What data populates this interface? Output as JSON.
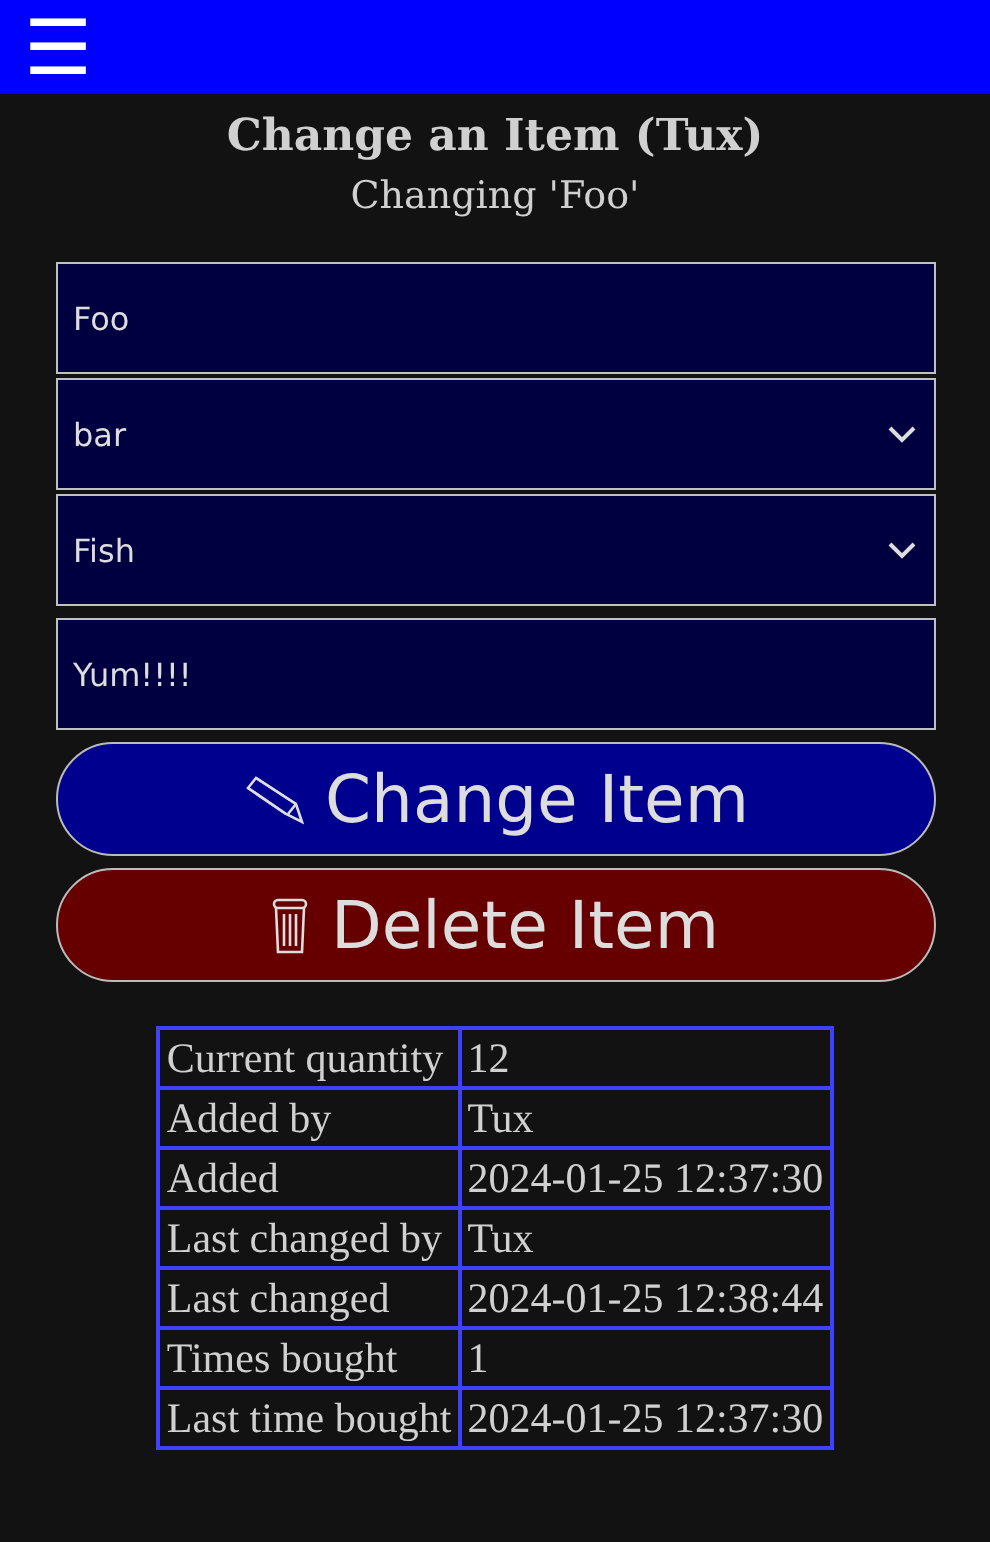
{
  "header": {
    "menu": "☰"
  },
  "title": "Change an Item (Tux)",
  "subtitle": "Changing 'Foo'",
  "fields": [
    {
      "kind": "text",
      "value": "Foo"
    },
    {
      "kind": "select",
      "value": "bar"
    },
    {
      "kind": "select",
      "value": "Fish"
    },
    {
      "kind": "text",
      "value": "Yum!!!!"
    }
  ],
  "buttons": [
    {
      "kind": "change",
      "label": "Change Item"
    },
    {
      "kind": "delete",
      "label": "Delete Item"
    }
  ],
  "details": [
    {
      "label": "Current quantity",
      "value": "12"
    },
    {
      "label": "Added by",
      "value": "Tux"
    },
    {
      "label": "Added",
      "value": "2024-01-25 12:37:30"
    },
    {
      "label": "Last changed by",
      "value": "Tux"
    },
    {
      "label": "Last changed",
      "value": "2024-01-25 12:38:44"
    },
    {
      "label": "Times bought",
      "value": "1"
    },
    {
      "label": "Last time bought",
      "value": "2024-01-25 12:37:30"
    }
  ]
}
